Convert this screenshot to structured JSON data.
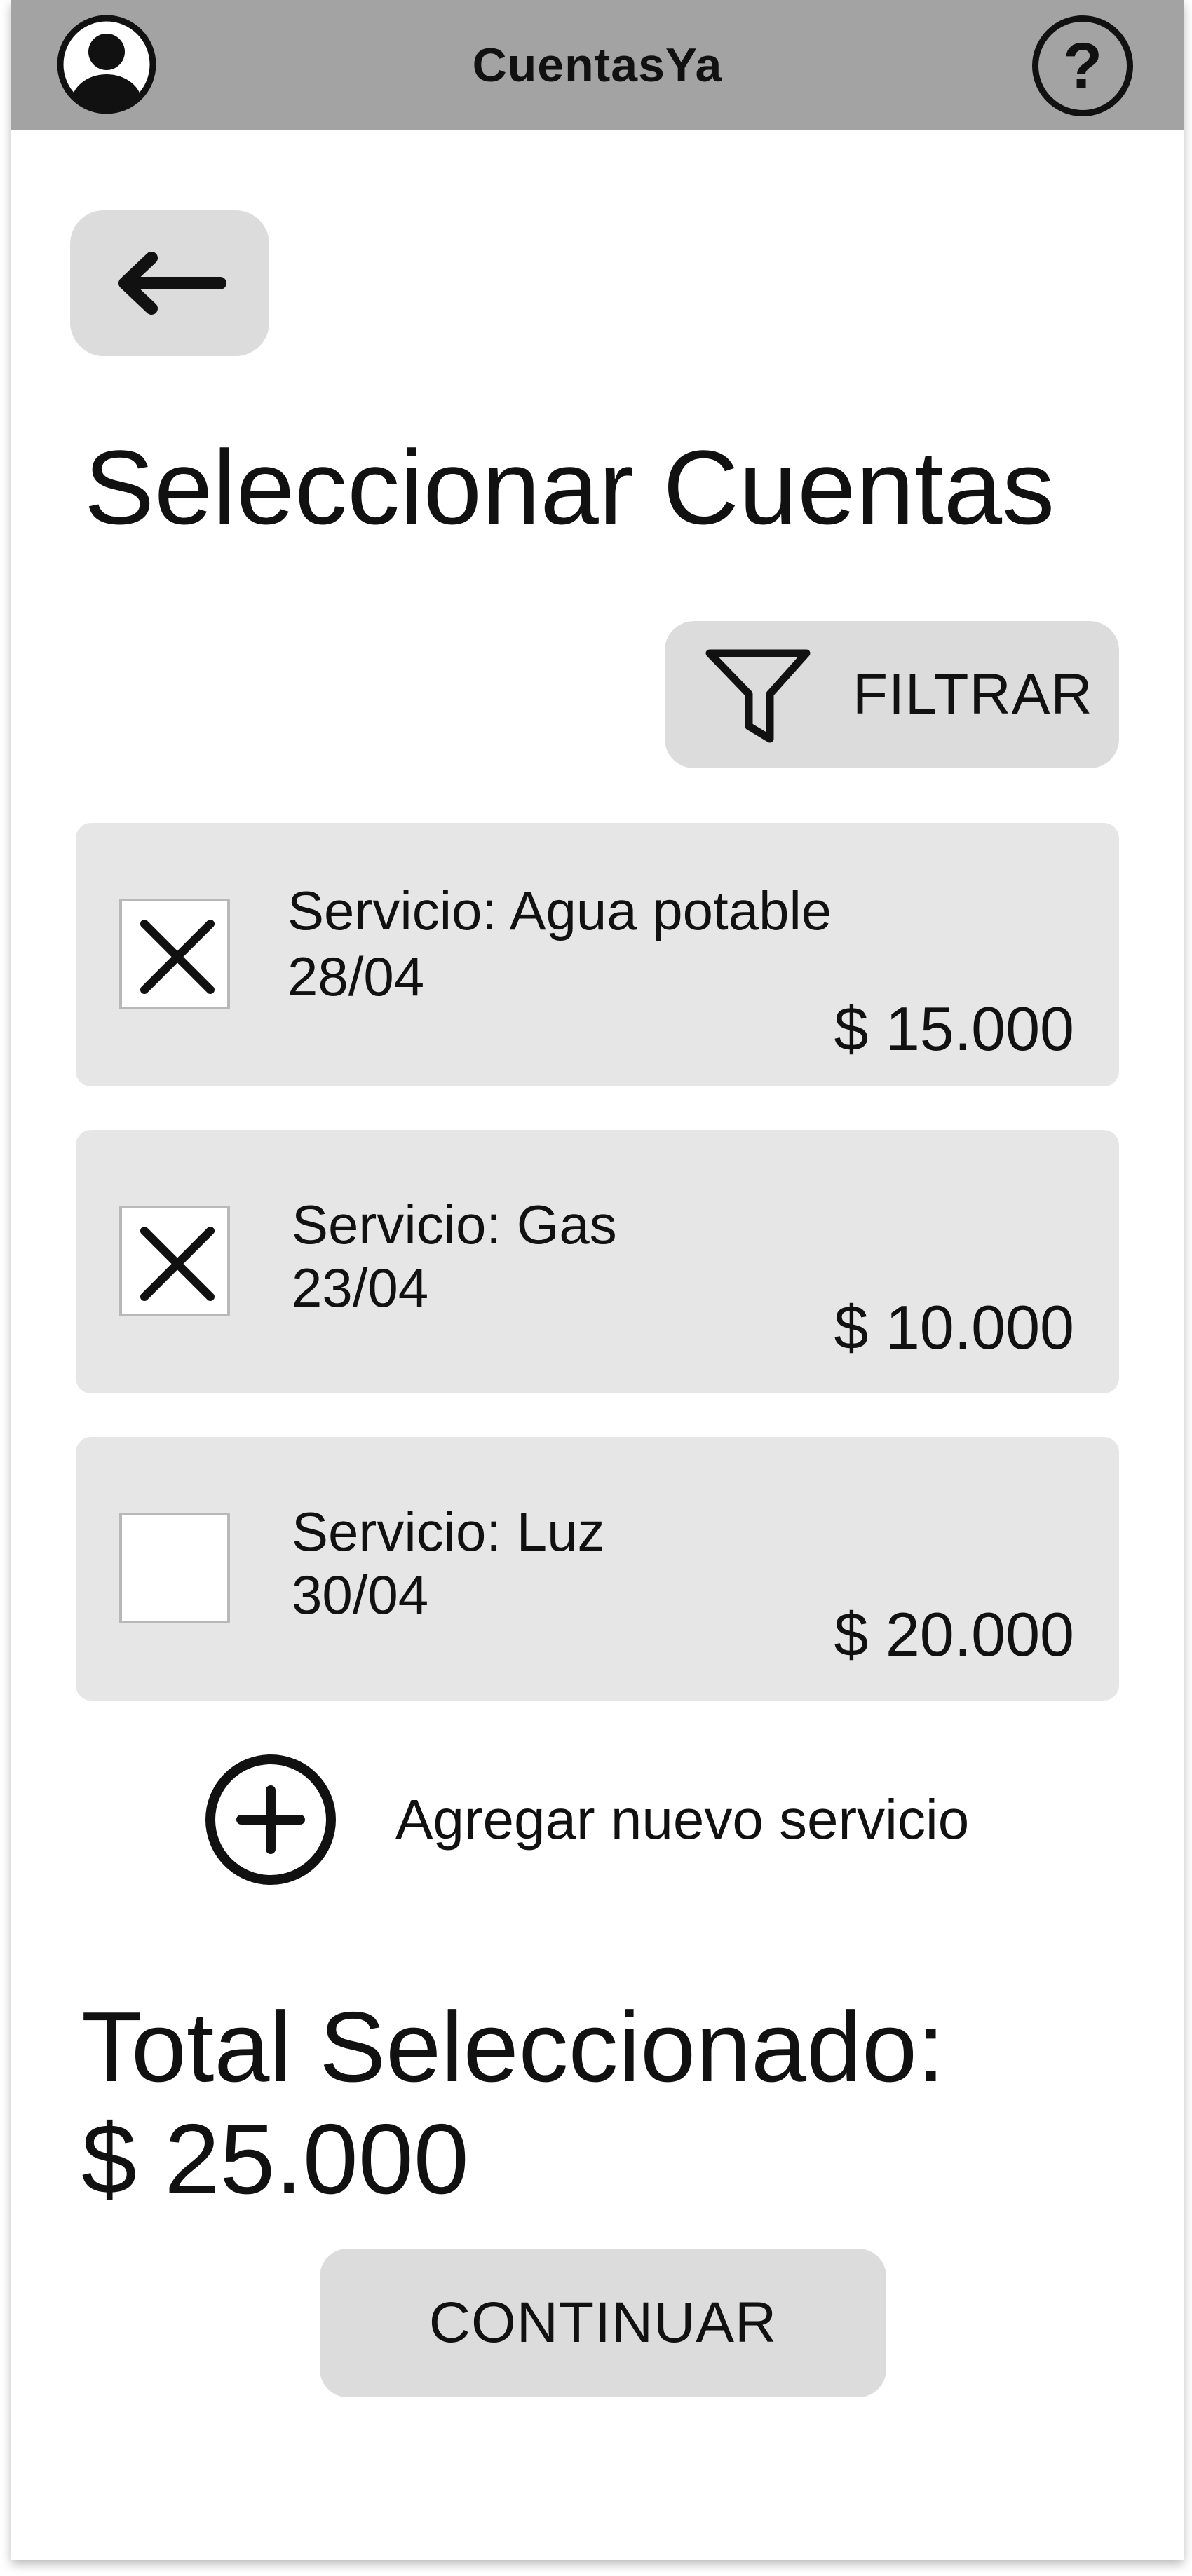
{
  "app": {
    "title": "CuentasYa",
    "help_glyph": "?"
  },
  "icons": {
    "avatar": "user-avatar-icon",
    "help": "question-mark-icon",
    "back": "arrow-left-icon",
    "filter": "funnel-icon",
    "checked": "x-mark-icon",
    "add": "plus-circle-icon"
  },
  "page": {
    "title": "Seleccionar Cuentas"
  },
  "filter": {
    "label": "FILTRAR"
  },
  "accounts": [
    {
      "name": "Servicio: Agua potable",
      "date": "28/04",
      "amount": "$ 15.000",
      "selected": true
    },
    {
      "name": "Servicio: Gas",
      "date": "23/04",
      "amount": "$ 10.000",
      "selected": true
    },
    {
      "name": "Servicio: Luz",
      "date": "30/04",
      "amount": "$ 20.000",
      "selected": false
    }
  ],
  "add_service": {
    "label": "Agregar nuevo servicio"
  },
  "total": {
    "label": "Total Seleccionado:",
    "value": "$ 25.000"
  },
  "continue": {
    "label": "CONTINUAR"
  },
  "colors": {
    "topbar": "#a3a3a3",
    "button": "#dcdcdc",
    "card": "#e6e6e6",
    "text": "#111111"
  }
}
